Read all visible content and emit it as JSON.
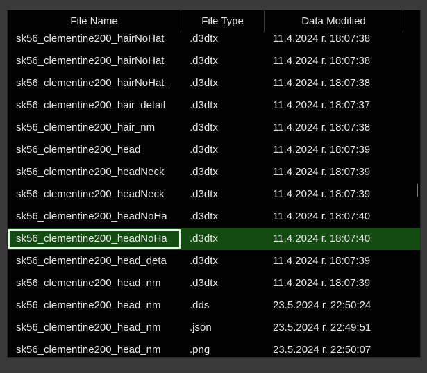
{
  "columns": {
    "name": "File Name",
    "type": "File Type",
    "date": "Data Modified"
  },
  "selected_index": 9,
  "rows": [
    {
      "name": "sk56_clementine200_hairNoHat",
      "type": ".d3dtx",
      "date": "11.4.2024 г. 18:07:38"
    },
    {
      "name": "sk56_clementine200_hairNoHat",
      "type": ".d3dtx",
      "date": "11.4.2024 г. 18:07:38"
    },
    {
      "name": "sk56_clementine200_hairNoHat_",
      "type": ".d3dtx",
      "date": "11.4.2024 г. 18:07:38"
    },
    {
      "name": "sk56_clementine200_hair_detail",
      "type": ".d3dtx",
      "date": "11.4.2024 г. 18:07:37"
    },
    {
      "name": "sk56_clementine200_hair_nm",
      "type": ".d3dtx",
      "date": "11.4.2024 г. 18:07:38"
    },
    {
      "name": "sk56_clementine200_head",
      "type": ".d3dtx",
      "date": "11.4.2024 г. 18:07:39"
    },
    {
      "name": "sk56_clementine200_headNeck",
      "type": ".d3dtx",
      "date": "11.4.2024 г. 18:07:39"
    },
    {
      "name": "sk56_clementine200_headNeck",
      "type": ".d3dtx",
      "date": "11.4.2024 г. 18:07:39"
    },
    {
      "name": "sk56_clementine200_headNoHa",
      "type": ".d3dtx",
      "date": "11.4.2024 г. 18:07:40"
    },
    {
      "name": "sk56_clementine200_headNoHa",
      "type": ".d3dtx",
      "date": "11.4.2024 г. 18:07:40"
    },
    {
      "name": "sk56_clementine200_head_deta",
      "type": ".d3dtx",
      "date": "11.4.2024 г. 18:07:39"
    },
    {
      "name": "sk56_clementine200_head_nm",
      "type": ".d3dtx",
      "date": "11.4.2024 г. 18:07:39"
    },
    {
      "name": "sk56_clementine200_head_nm",
      "type": ".dds",
      "date": "23.5.2024 г. 22:50:24"
    },
    {
      "name": "sk56_clementine200_head_nm",
      "type": ".json",
      "date": "23.5.2024 г. 22:49:51"
    },
    {
      "name": "sk56_clementine200_head_nm",
      "type": ".png",
      "date": "23.5.2024 г. 22:50:07"
    }
  ]
}
